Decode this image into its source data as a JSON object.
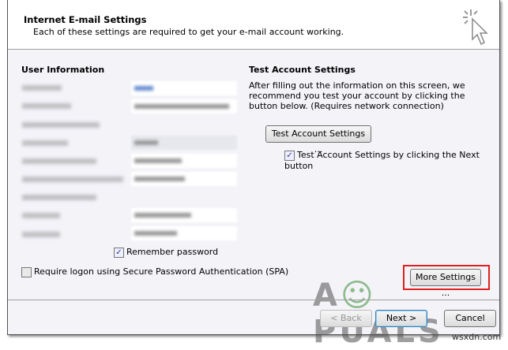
{
  "header": {
    "title": "Internet E-mail Settings",
    "subtitle": "Each of these settings are required to get your e-mail account working."
  },
  "user_info": {
    "heading": "User Information",
    "remember_password": "Remember password",
    "spa": "Require logon using Secure Password Authentication (SPA)"
  },
  "test": {
    "heading": "Test Account Settings",
    "description": "After filling out the information on this screen, we recommend you test your account by clicking the button below. (Requires network connection)",
    "button": "Test Account Settings ...",
    "checkbox": "Test Account Settings by clicking the Next button"
  },
  "buttons": {
    "more": "More Settings ...",
    "back": "< Back",
    "next": "Next >",
    "cancel": "Cancel"
  },
  "watermark": {
    "logo": "APPUALS",
    "site": "wsxdn.com"
  },
  "colors": {
    "highlight": "#e02020",
    "accent": "#3a7bd5"
  }
}
